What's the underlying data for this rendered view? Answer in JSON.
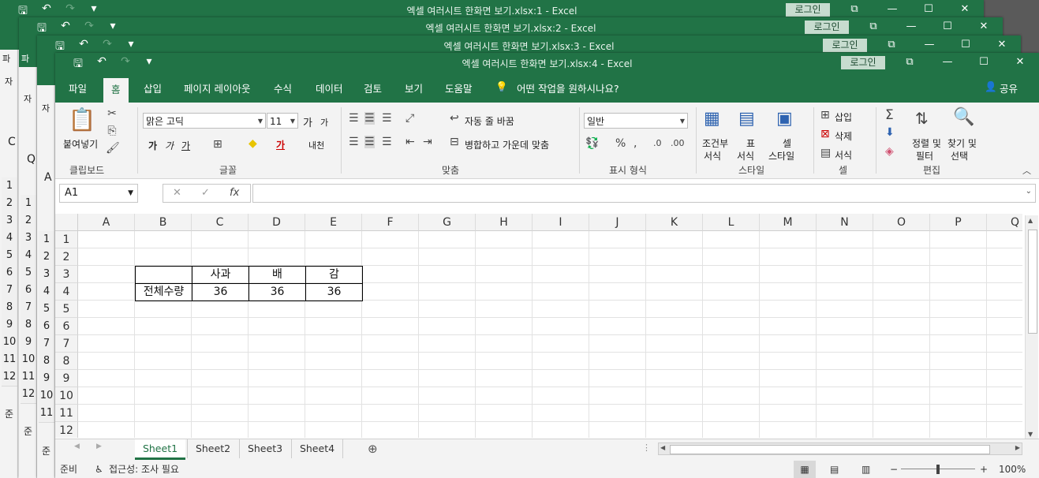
{
  "windows": [
    {
      "title": "엑셀 여러시트 한화면 보기.xlsx:1  -  Excel",
      "login": "로그인"
    },
    {
      "title": "엑셀 여러시트 한화면 보기.xlsx:2  -  Excel",
      "login": "로그인"
    },
    {
      "title": "엑셀 여러시트 한화면 보기.xlsx:3  -  Excel",
      "login": "로그인"
    },
    {
      "title": "엑셀 여러시트 한화면 보기.xlsx:4  -  Excel",
      "login": "로그인"
    }
  ],
  "background_windows": {
    "row_numbers": [
      "1",
      "2",
      "3",
      "4",
      "5",
      "6",
      "7",
      "8",
      "9",
      "10",
      "11",
      "12"
    ],
    "status_text": "준비",
    "status_text_short": "준",
    "ribbon_char": "파",
    "ribbon_char2": "자",
    "search_chars": [
      "C",
      "Q",
      "A"
    ]
  },
  "ribbon_tabs": [
    "파일",
    "홈",
    "삽입",
    "페이지 레이아웃",
    "수식",
    "데이터",
    "검토",
    "보기",
    "도움말"
  ],
  "tell_me": "어떤 작업을 원하시나요?",
  "share": "공유",
  "ribbon": {
    "paste": "붙여넣기",
    "font_name": "맑은 고딕",
    "font_size": "11",
    "wrap_text": "자동 줄 바꿈",
    "merge_center": "병합하고 가운데 맞춤",
    "number_format": "일반",
    "conditional_format": [
      "조건부",
      "서식"
    ],
    "format_table": [
      "표",
      "서식"
    ],
    "cell_styles": [
      "셀",
      "스타일"
    ],
    "insert": "삽입",
    "delete": "삭제",
    "format": "서식",
    "sort_filter": [
      "정렬 및",
      "필터"
    ],
    "find_select": [
      "찾기 및",
      "선택"
    ],
    "groups": [
      "클립보드",
      "글꼴",
      "맞춤",
      "표시 형식",
      "스타일",
      "셀",
      "편집"
    ],
    "font_buttons": [
      "가",
      "가",
      "가",
      "가",
      "가",
      "가",
      "내천"
    ]
  },
  "formula_bar": {
    "name_box": "A1",
    "fx": "fx",
    "cancel": "✕",
    "enter": "✓",
    "value": ""
  },
  "grid": {
    "columns": [
      "A",
      "B",
      "C",
      "D",
      "E",
      "F",
      "G",
      "H",
      "I",
      "J",
      "K",
      "L",
      "M",
      "N",
      "O",
      "P",
      "Q"
    ],
    "rows": [
      "1",
      "2",
      "3",
      "4",
      "5",
      "6",
      "7",
      "8",
      "9",
      "10",
      "11",
      "12"
    ],
    "table": {
      "headers": [
        "",
        "사과",
        "배",
        "감"
      ],
      "row_label": "전체수량",
      "values": [
        "36",
        "36",
        "36"
      ]
    }
  },
  "sheets": [
    "Sheet1",
    "Sheet2",
    "Sheet3",
    "Sheet4"
  ],
  "status": {
    "ready": "준비",
    "accessibility": "접근성: 조사 필요",
    "zoom": "100%"
  },
  "colors": {
    "excel_green": "#217346"
  }
}
